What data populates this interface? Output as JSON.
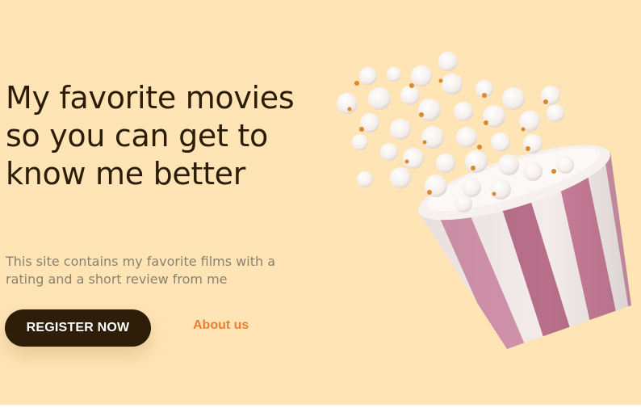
{
  "hero": {
    "headline": "My favorite movies so you can get to know me better",
    "subtitle": "This site contains my favorite films with a rating and a short review from me",
    "primary_button": "REGISTER NOW",
    "secondary_link": "About us"
  },
  "illustration": {
    "icon": "popcorn-bucket-icon"
  },
  "colors": {
    "background": "#ffe4b5",
    "headline": "#2b1d08",
    "subtitle": "#8a8070",
    "button_bg": "#2e1d08",
    "button_text": "#ffffff",
    "link": "#e87f34",
    "stripe_pink": "#c97f9a",
    "stripe_white": "#f3ecea"
  }
}
